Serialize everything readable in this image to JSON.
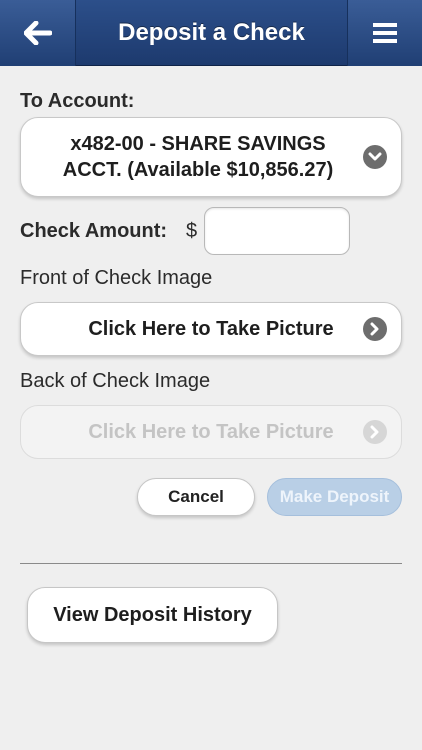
{
  "header": {
    "title": "Deposit a Check",
    "back_icon": "arrow-left-icon",
    "menu_icon": "hamburger-menu-icon"
  },
  "account": {
    "label": "To Account:",
    "selected_line1": "x482-00 - SHARE SAVINGS",
    "selected_line2": "ACCT. (Available $10,856.27)",
    "icon": "chevron-down-icon"
  },
  "amount": {
    "label": "Check Amount:",
    "currency": "$",
    "value": "",
    "placeholder": ""
  },
  "front": {
    "label": "Front of Check Image",
    "button": "Click Here to Take Picture",
    "icon": "chevron-right-icon"
  },
  "back": {
    "label": "Back of Check Image",
    "button": "Click Here to Take Picture",
    "icon": "chevron-right-icon"
  },
  "actions": {
    "cancel": "Cancel",
    "make_deposit": "Make Deposit"
  },
  "history": {
    "label": "View Deposit History"
  },
  "colors": {
    "header": "#1d3a6e",
    "background": "#efefef",
    "deposit_disabled": "#b9cfe6"
  }
}
